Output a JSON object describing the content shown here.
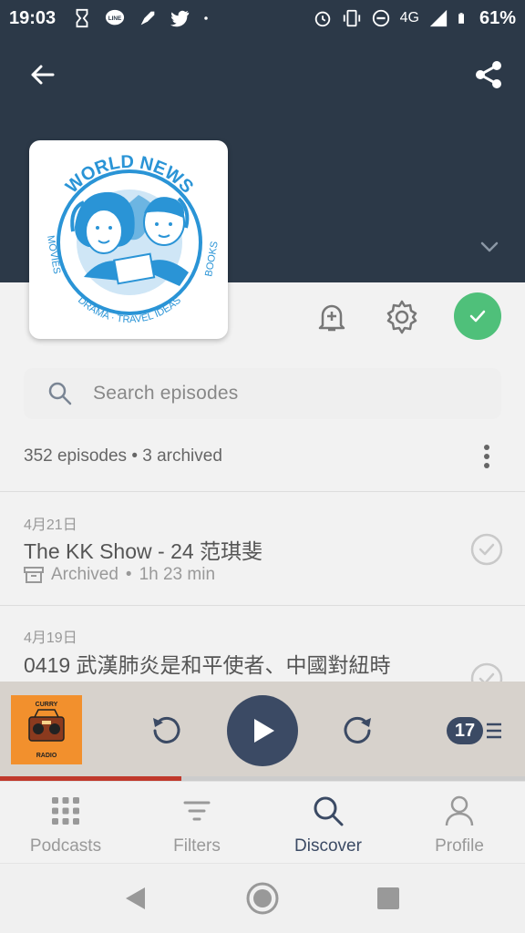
{
  "status_bar": {
    "time": "19:03",
    "network": "4G",
    "battery": "61%",
    "left_icons": [
      "hourglass-icon",
      "line-icon",
      "rocket-icon",
      "twitter-icon",
      "dot-icon"
    ],
    "right_icons": [
      "alarm-icon",
      "vibrate-icon",
      "dnd-icon",
      "signal-icon",
      "battery-icon"
    ]
  },
  "header": {
    "back_icon": "arrow-left-icon",
    "share_icon": "share-icon",
    "expand_icon": "chevron-down-icon",
    "background_color": "#2c3948"
  },
  "podcast_artwork": {
    "title_text": "WORLD NEWS",
    "left_arc_text": "MOVIES",
    "bottom_arc_text": "DRAMA · TRAVEL IDEAS",
    "right_arc_text": "BOOKS",
    "accent_color": "#2a94d6"
  },
  "actions": {
    "notify_icon": "bell-plus-icon",
    "settings_icon": "gear-icon",
    "subscribed_icon": "check-icon",
    "subscribed_color": "#4fc07a"
  },
  "search": {
    "placeholder": "Search episodes"
  },
  "episode_summary": "352 episodes • 3 archived",
  "episodes": [
    {
      "date": "4月21日",
      "title": "The KK Show - 24 范琪斐",
      "status": "Archived",
      "duration": "1h 23 min",
      "meta_separator": "•"
    },
    {
      "date": "4月19日",
      "title": "0419 武漢肺炎是和平使者、中國對紐時"
    }
  ],
  "mini_player": {
    "artwork_text_top": "CURRY",
    "artwork_text_bottom": "RADIO",
    "queue_count": "17",
    "progress": 0.345,
    "progress_color": "#c0392b"
  },
  "bottom_nav": {
    "items": [
      {
        "label": "Podcasts",
        "icon": "grid-icon"
      },
      {
        "label": "Filters",
        "icon": "filter-icon"
      },
      {
        "label": "Discover",
        "icon": "search-icon",
        "active": true
      },
      {
        "label": "Profile",
        "icon": "person-icon"
      }
    ]
  },
  "system_nav": [
    "back-triangle-icon",
    "home-circle-icon",
    "recents-square-icon"
  ]
}
